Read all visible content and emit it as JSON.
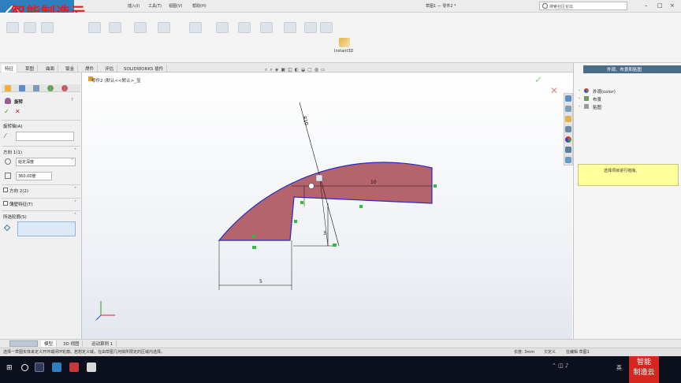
{
  "watermark": "智能制造云",
  "menu": [
    "插入(I)",
    "工具(T)",
    "视图(V)",
    "帮助(H)"
  ],
  "doc_title": "草图1 — 零件2 *",
  "search": {
    "placeholder": "搜索社区论坛"
  },
  "ribbon": {
    "instant3d": "Instant3D"
  },
  "tabs": [
    "特征",
    "草图",
    "曲面",
    "钣金",
    "焊件",
    "评估",
    "SOLIDWORKS 插件"
  ],
  "tree": {
    "title": "零件2 (默认<<默认>_显"
  },
  "pm": {
    "title": "旋转",
    "axis_header": "旋转轴(A)",
    "dir1_header": "方向 1(1)",
    "dir1_type": "给定深度",
    "angle": "360.00度",
    "dir2_header": "方向 2(2)",
    "thin_header": "薄壁特征(T)",
    "contours_header": "所选轮廓(S)"
  },
  "sketch": {
    "dim_top": "10",
    "dim_diag": "R10",
    "dim_bottom": "5",
    "dim_vert": "3"
  },
  "taskpane": {
    "title": "外观、布景和贴图",
    "items": [
      "外观(color)",
      "布景",
      "贴图"
    ],
    "note": "选择项目进行拖拽。"
  },
  "bottom_tabs": [
    "模型",
    "3D 视图",
    "运动算例 1"
  ],
  "status": {
    "left": "选择一草图实体来定义开环或闭环轮廓。若想定义域，在由草图几何体所限定的区域内选择。",
    "length": "长度: 3mm",
    "defined": "欠定义",
    "editing": "在编辑 草图1"
  },
  "taskbar": {
    "lang": "英",
    "badge": [
      "智能",
      "制造云"
    ]
  },
  "colors": {
    "profile_fill": "#b5646b",
    "profile_stroke": "#2a2ac8",
    "accent": "#2f7fbf",
    "brand_red": "#d6261f"
  }
}
